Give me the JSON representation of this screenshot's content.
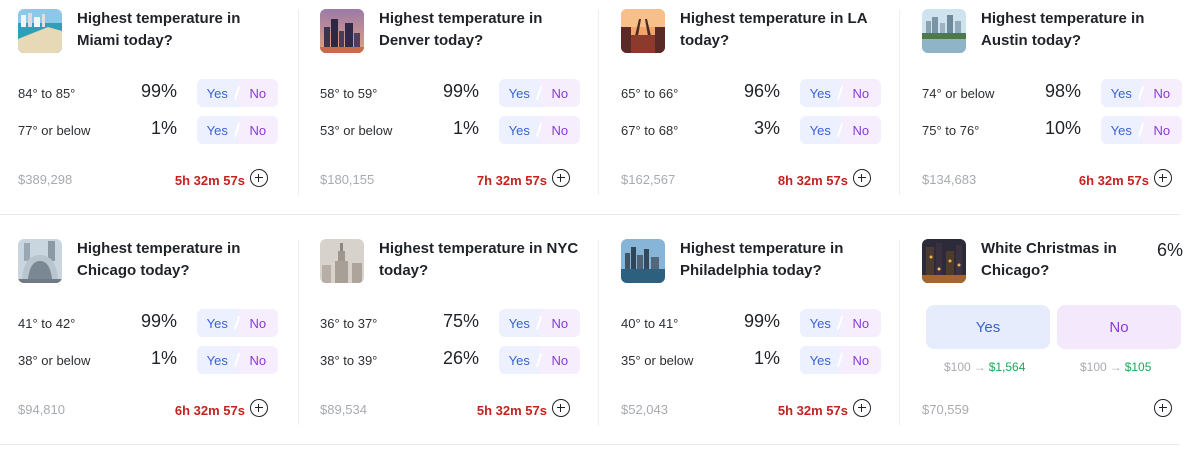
{
  "markets": [
    {
      "title": "Highest temperature in Miami today?",
      "thumb": "miami-beach",
      "outcomes": [
        {
          "label": "84° to 85°",
          "pct": "99%",
          "yes": "Yes",
          "no": "No"
        },
        {
          "label": "77° or below",
          "pct": "1%",
          "yes": "Yes",
          "no": "No"
        }
      ],
      "volume": "$389,298",
      "timer": "5h 32m 57s"
    },
    {
      "title": "Highest temperature in Denver today?",
      "thumb": "denver-skyline",
      "outcomes": [
        {
          "label": "58° to 59°",
          "pct": "99%",
          "yes": "Yes",
          "no": "No"
        },
        {
          "label": "53° or below",
          "pct": "1%",
          "yes": "Yes",
          "no": "No"
        }
      ],
      "volume": "$180,155",
      "timer": "7h 32m 57s"
    },
    {
      "title": "Highest temperature in LA today?",
      "thumb": "la-street",
      "outcomes": [
        {
          "label": "65° to 66°",
          "pct": "96%",
          "yes": "Yes",
          "no": "No"
        },
        {
          "label": "67° to 68°",
          "pct": "3%",
          "yes": "Yes",
          "no": "No"
        }
      ],
      "volume": "$162,567",
      "timer": "8h 32m 57s"
    },
    {
      "title": "Highest temperature in Austin today?",
      "thumb": "austin-river",
      "outcomes": [
        {
          "label": "74° or below",
          "pct": "98%",
          "yes": "Yes",
          "no": "No"
        },
        {
          "label": "75° to 76°",
          "pct": "10%",
          "yes": "Yes",
          "no": "No"
        }
      ],
      "volume": "$134,683",
      "timer": "6h 32m 57s"
    },
    {
      "title": "Highest temperature in Chicago today?",
      "thumb": "chicago-bean",
      "outcomes": [
        {
          "label": "41° to 42°",
          "pct": "99%",
          "yes": "Yes",
          "no": "No"
        },
        {
          "label": "38° or below",
          "pct": "1%",
          "yes": "Yes",
          "no": "No"
        }
      ],
      "volume": "$94,810",
      "timer": "6h 32m 57s"
    },
    {
      "title": "Highest temperature in NYC today?",
      "thumb": "nyc-empire",
      "outcomes": [
        {
          "label": "36° to 37°",
          "pct": "75%",
          "yes": "Yes",
          "no": "No"
        },
        {
          "label": "38° to 39°",
          "pct": "26%",
          "yes": "Yes",
          "no": "No"
        }
      ],
      "volume": "$89,534",
      "timer": "5h 32m 57s"
    },
    {
      "title": "Highest temperature in Philadelphia today?",
      "thumb": "philadelphia-skyline",
      "outcomes": [
        {
          "label": "40° to 41°",
          "pct": "99%",
          "yes": "Yes",
          "no": "No"
        },
        {
          "label": "35° or below",
          "pct": "1%",
          "yes": "Yes",
          "no": "No"
        }
      ],
      "volume": "$52,043",
      "timer": "5h 32m 57s"
    }
  ],
  "special": {
    "title": "White Christmas in Chicago?",
    "thumb": "chicago-night",
    "pct": "6%",
    "yes": "Yes",
    "no": "No",
    "yes_payout": {
      "stake": "$100",
      "arrow": "→",
      "win": "$1,564"
    },
    "no_payout": {
      "stake": "$100",
      "arrow": "→",
      "win": "$105"
    },
    "volume": "$70,559"
  },
  "colors": {
    "yes_text": "#3a62d6",
    "no_text": "#8a39d8",
    "timer": "#c5221f",
    "payout_win": "#1ea55a"
  }
}
